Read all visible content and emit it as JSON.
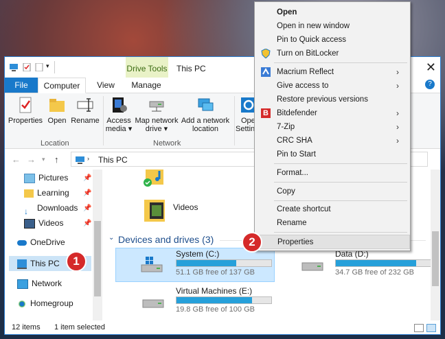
{
  "window": {
    "title": "This PC",
    "context_tab": "Drive Tools",
    "close_glyph": "✕"
  },
  "ribbon_tabs": {
    "file": "File",
    "computer": "Computer",
    "view": "View",
    "manage": "Manage"
  },
  "ribbon": {
    "properties": "Properties",
    "open": "Open",
    "rename": "Rename",
    "access_media_1": "Access",
    "access_media_2": "media ▾",
    "map_drive_1": "Map network",
    "map_drive_2": "drive ▾",
    "add_location_1": "Add a network",
    "add_location_2": "location",
    "open_settings_1": "Ope",
    "open_settings_2": "Settin",
    "group_location": "Location",
    "group_network": "Network"
  },
  "address": {
    "path": "This PC"
  },
  "nav": {
    "pictures": "Pictures",
    "learning": "Learning",
    "downloads": "Downloads",
    "videos": "Videos",
    "onedrive": "OneDrive",
    "thispc": "This PC",
    "network": "Network",
    "homegroup": "Homegroup"
  },
  "content": {
    "videos_folder": "Videos",
    "devices_header": "Devices and drives (3)",
    "drives": [
      {
        "name": "System (C:)",
        "free": "51.1 GB free of 137 GB",
        "used_fraction": 0.63
      },
      {
        "name": "Data (D:)",
        "free": "34.7 GB free of 232 GB",
        "used_fraction": 0.85
      },
      {
        "name": "Virtual Machines (E:)",
        "free": "19.8 GB free of 100 GB",
        "used_fraction": 0.8
      }
    ]
  },
  "status": {
    "items": "12 items",
    "selected": "1 item selected"
  },
  "context_menu": {
    "open": "Open",
    "open_new_window": "Open in new window",
    "pin_quick_access": "Pin to Quick access",
    "bitlocker": "Turn on BitLocker",
    "macrium": "Macrium Reflect",
    "give_access": "Give access to",
    "restore": "Restore previous versions",
    "bitdefender": "Bitdefender",
    "zip": "7-Zip",
    "crc": "CRC SHA",
    "pin_start": "Pin to Start",
    "format": "Format...",
    "copy": "Copy",
    "create_shortcut": "Create shortcut",
    "rename": "Rename",
    "properties": "Properties",
    "submenu_arrow": "›"
  },
  "callouts": {
    "one": "1",
    "two": "2"
  },
  "colors": {
    "accent": "#1979ca",
    "callout": "#d52a2a",
    "drive_bar": "#26a0da"
  }
}
